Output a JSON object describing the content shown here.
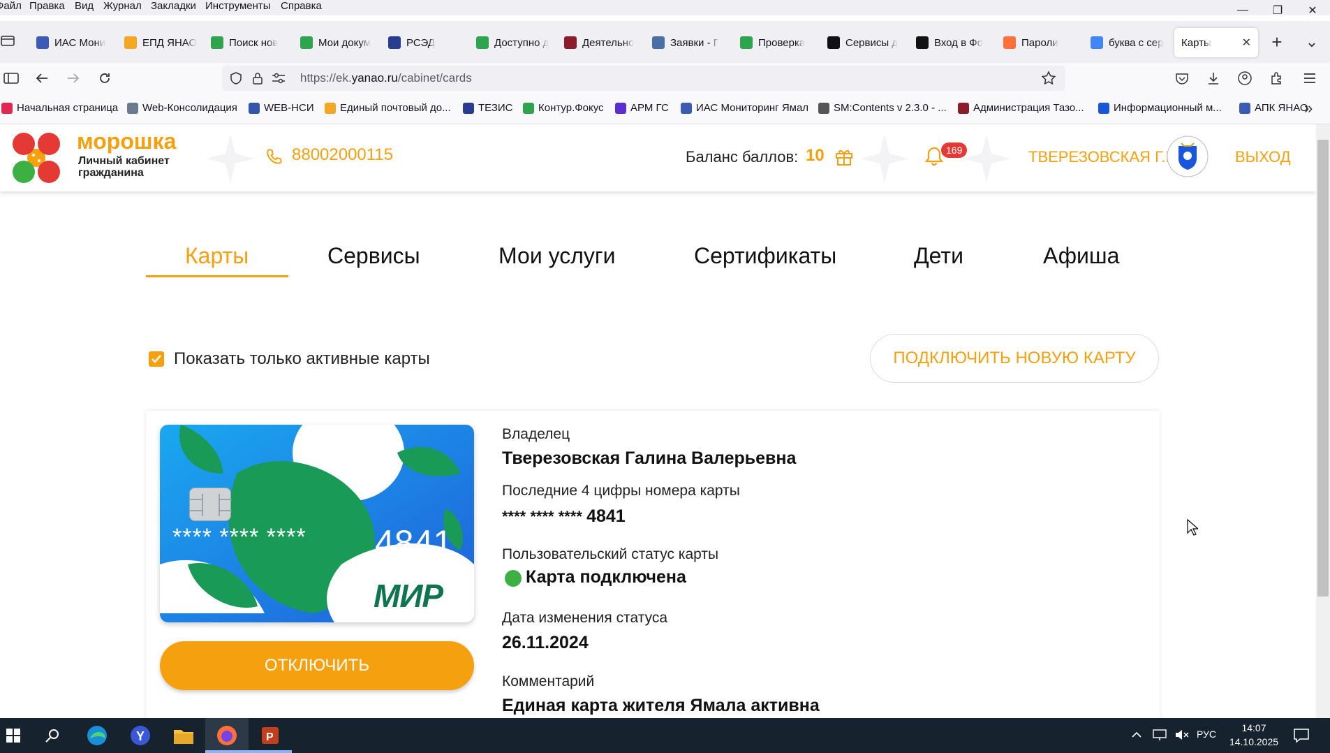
{
  "menubar": {
    "items": [
      "Файл",
      "Правка",
      "Вид",
      "Журнал",
      "Закладки",
      "Инструменты",
      "Справка"
    ]
  },
  "window_controls": {
    "minimize": "—",
    "restore": "❐",
    "close": "✕"
  },
  "tabs": [
    {
      "label": "ИАС Мони",
      "icon_color": "#3b5bb5"
    },
    {
      "label": "ЕПД ЯНАО",
      "icon_color": "#f5a623"
    },
    {
      "label": "Поиск нов",
      "icon_color": "#2ea44f"
    },
    {
      "label": "Мои докум",
      "icon_color": "#2ea44f"
    },
    {
      "label": "РСЭД",
      "icon_color": "#2a3c8f"
    },
    {
      "label": "Доступно д",
      "icon_color": "#2ea44f"
    },
    {
      "label": "Деятельно",
      "icon_color": "#8b1c2c"
    },
    {
      "label": "Заявки - Г",
      "icon_color": "#4a6fa5"
    },
    {
      "label": "Проверка",
      "icon_color": "#2ea44f"
    },
    {
      "label": "Сервисы д",
      "icon_color": "#111111"
    },
    {
      "label": "Вход в Фо",
      "icon_color": "#111111"
    },
    {
      "label": "Пароли",
      "icon_color": "#ff7139"
    },
    {
      "label": "буква с сер",
      "icon_color": "#4285f4"
    },
    {
      "label": "Карты",
      "icon_color": "",
      "active": true
    }
  ],
  "tab_close": "✕",
  "new_tab": "+",
  "tab_list": "⌄",
  "url": {
    "prefix": "https://ek.",
    "host": "yanao.ru",
    "path": "/cabinet/cards"
  },
  "bookmarks": [
    {
      "label": "Начальная страница",
      "icon_color": "#e22850"
    },
    {
      "label": "Web-Консолидация",
      "icon_color": "#6b7a8f"
    },
    {
      "label": "WEB-НСИ",
      "icon_color": "#3355aa"
    },
    {
      "label": "Единый почтовый до...",
      "icon_color": "#f5a623"
    },
    {
      "label": "ТЕЗИС",
      "icon_color": "#2a3c8f"
    },
    {
      "label": "Контур.Фокус",
      "icon_color": "#2ea44f"
    },
    {
      "label": "АРМ ГС",
      "icon_color": "#5b2ecf"
    },
    {
      "label": "ИАС Мониторинг Ямал",
      "icon_color": "#3b5bb5"
    },
    {
      "label": "SM:Contents v 2.3.0 - ...",
      "icon_color": "#555555"
    },
    {
      "label": "Администрация Тазо...",
      "icon_color": "#8b1c2c"
    },
    {
      "label": "Информационный м...",
      "icon_color": "#1a56db"
    },
    {
      "label": "АПК ЯНАО",
      "icon_color": "#3b5bb5"
    }
  ],
  "bookmarks_more": "»",
  "site": {
    "logo_name": "морошка",
    "logo_subtitle_1": "Личный кабинет",
    "logo_subtitle_2": "гражданина",
    "phone": "88002000115",
    "balance_label": "Баланс баллов:",
    "balance_value": "10",
    "notifications_count": "169",
    "user_name": "ТВЕРЕЗОВСКАЯ Г.В.",
    "logout": "ВЫХОД",
    "accent_color": "#f5a00f"
  },
  "nav_tabs": [
    {
      "label": "Карты",
      "active": true
    },
    {
      "label": "Сервисы"
    },
    {
      "label": "Мои услуги"
    },
    {
      "label": "Сертификаты"
    },
    {
      "label": "Дети"
    },
    {
      "label": "Афиша"
    }
  ],
  "filter": {
    "checked": true,
    "label": "Показать только активные карты"
  },
  "connect_button": "ПОДКЛЮЧИТЬ НОВУЮ КАРТУ",
  "card": {
    "masked": "**** **** ****",
    "last4": "4841",
    "brand": "МИР",
    "disconnect_button": "ОТКЛЮЧИТЬ",
    "owner_label": "Владелец",
    "owner_value": "Тверезовская Галина Валерьевна",
    "digits_label": "Последние 4 цифры номера карты",
    "digits_masked": "**** **** ****",
    "digits_value": "4841",
    "status_label": "Пользовательский статус карты",
    "status_value": "Карта подключена",
    "status_color": "#3cb043",
    "date_label": "Дата изменения статуса",
    "date_value": "26.11.2024",
    "comment_label": "Комментарий",
    "comment_value": "Единая карта жителя Ямала активна"
  },
  "taskbar": {
    "lang": "РУС",
    "time": "14:07",
    "date": "14.10.2025"
  }
}
